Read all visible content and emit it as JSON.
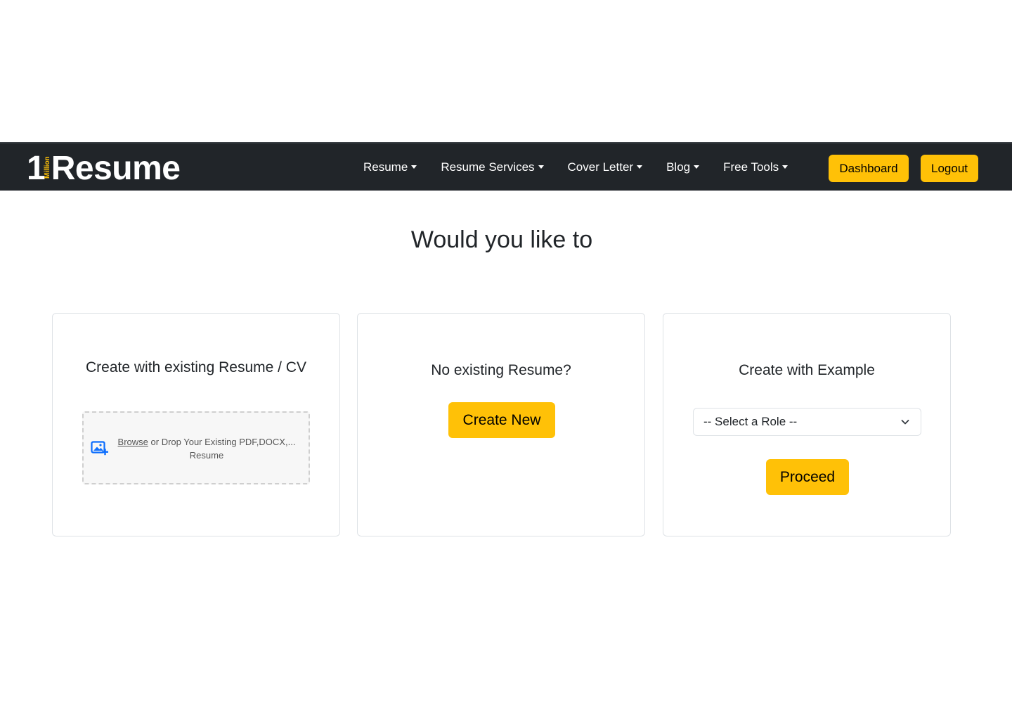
{
  "brand": {
    "digit": "1",
    "tagline": "Million",
    "word": "Resume"
  },
  "nav": {
    "items": [
      {
        "label": "Resume"
      },
      {
        "label": "Resume Services"
      },
      {
        "label": "Cover Letter"
      },
      {
        "label": "Blog"
      },
      {
        "label": "Free Tools"
      }
    ],
    "dashboard_label": "Dashboard",
    "logout_label": "Logout"
  },
  "main": {
    "heading": "Would you like to",
    "existing_card": {
      "title": "Create with existing Resume / CV",
      "dropzone": {
        "icon": "image-add-icon",
        "browse_label": "Browse",
        "text": " or Drop Your Existing  PDF,DOCX,... Resume"
      }
    },
    "new_card": {
      "title": "No existing Resume?",
      "button_label": "Create New"
    },
    "example_card": {
      "title": "Create with Example",
      "select_value": "-- Select a Role --",
      "button_label": "Proceed"
    }
  },
  "colors": {
    "accent": "#ffc107",
    "navbar_bg": "#212529",
    "icon_blue": "#0d6efd"
  }
}
